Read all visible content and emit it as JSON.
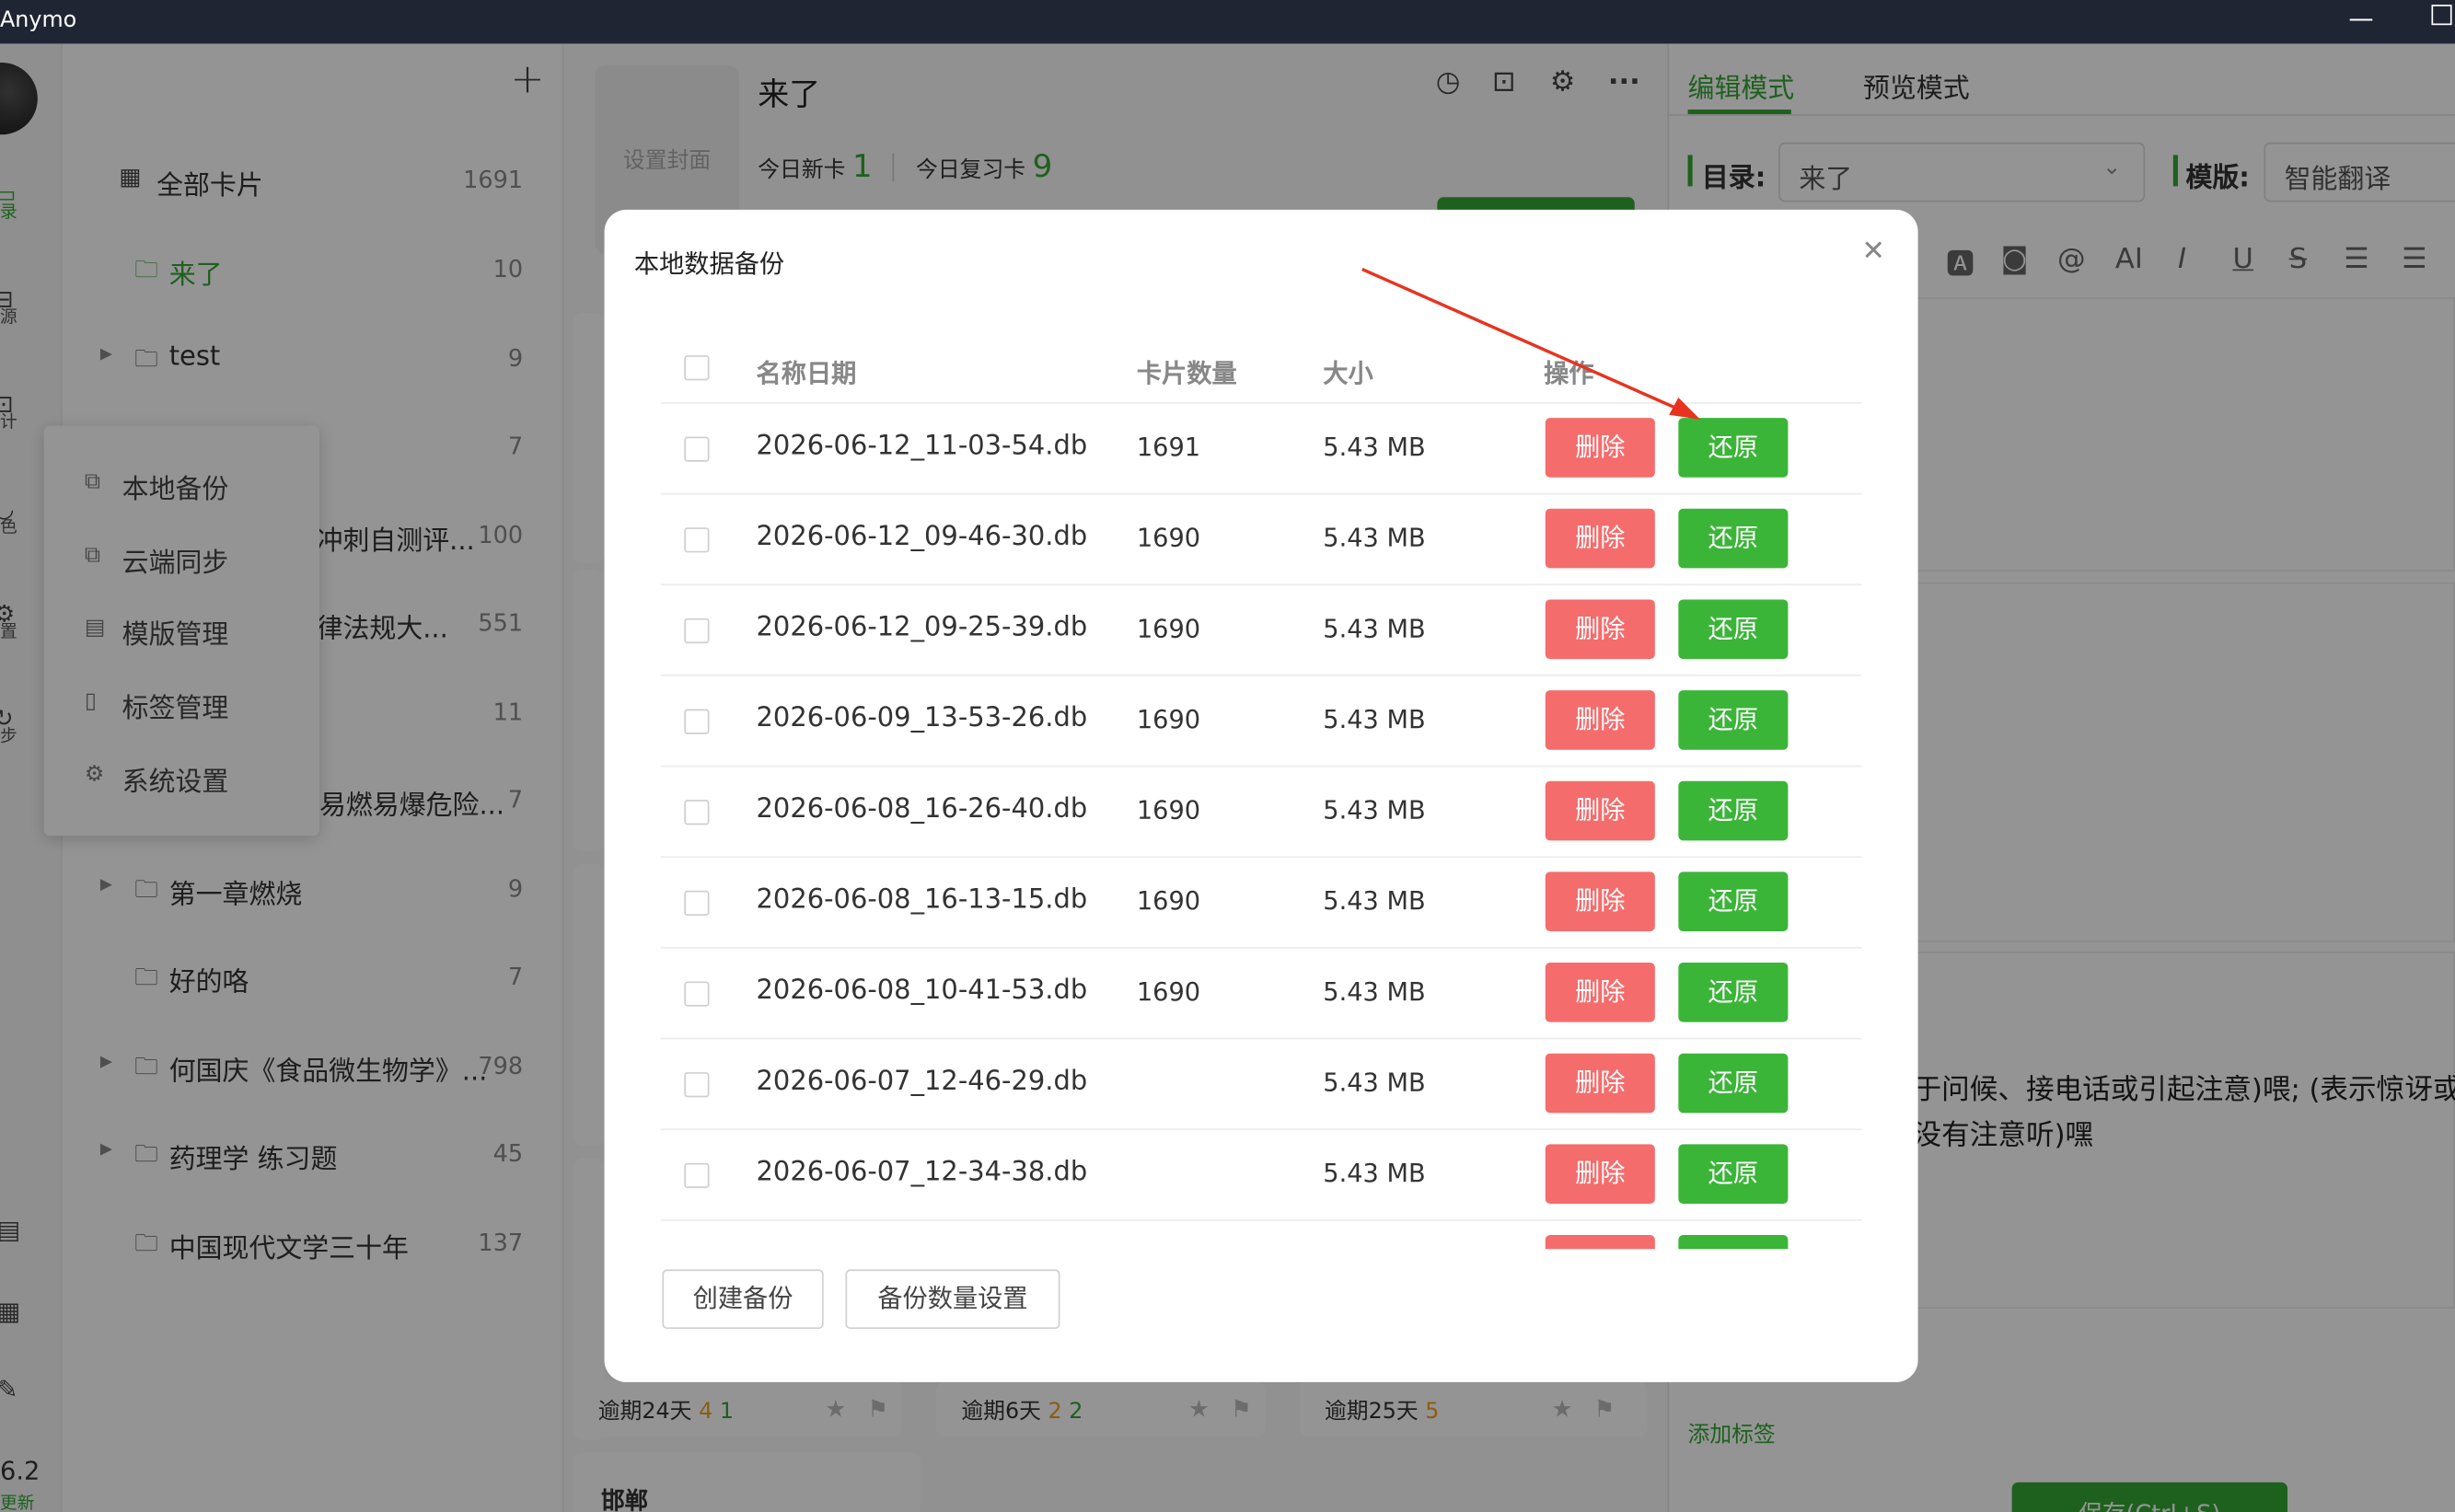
{
  "window": {
    "title": "Anymo"
  },
  "rail": {
    "items": [
      {
        "icon": "monitor-icon",
        "label": "录"
      },
      {
        "icon": "import-icon",
        "label": "源"
      },
      {
        "icon": "stats-icon",
        "label": "计"
      },
      {
        "icon": "palette-icon",
        "label": "色"
      },
      {
        "icon": "gear-icon",
        "label": "置"
      },
      {
        "icon": "sync-icon",
        "label": "步"
      }
    ],
    "version": "6.2",
    "update_label": "更新"
  },
  "folders": {
    "add_label": "+",
    "all_cards": {
      "label": "全部卡片",
      "count": "1691"
    },
    "items": [
      {
        "name": "来了",
        "count": "10",
        "active": true
      },
      {
        "name": "test",
        "count": "9"
      },
      {
        "name": "",
        "count": "7"
      },
      {
        "name": "冲刺自测评...",
        "count": "100"
      },
      {
        "name": "律法规大...",
        "count": "551"
      },
      {
        "name": "",
        "count": "11"
      },
      {
        "name": "易燃易爆危险...",
        "count": "7"
      },
      {
        "name": "第一章燃烧",
        "count": "9"
      },
      {
        "name": "好的咯",
        "count": "7"
      },
      {
        "name": "何国庆《食品微生物学》...",
        "count": "798"
      },
      {
        "name": "药理学 练习题",
        "count": "45"
      },
      {
        "name": "中国现代文学三十年",
        "count": "137"
      }
    ]
  },
  "menu": {
    "items": [
      {
        "label": "本地备份"
      },
      {
        "label": "云端同步"
      },
      {
        "label": "模版管理"
      },
      {
        "label": "标签管理"
      },
      {
        "label": "系统设置"
      }
    ]
  },
  "middle": {
    "cover_label": "设置封面",
    "title": "来了",
    "new_label": "今日新卡",
    "new_count": "1",
    "review_label": "今日复习卡",
    "review_count": "9",
    "card_footers": [
      {
        "text": "逾期24天",
        "n1": "4",
        "n2": "1"
      },
      {
        "text": "逾期6天",
        "n1": "2",
        "n2": "2"
      },
      {
        "text": "逾期25天",
        "n1": "5",
        "n2": ""
      }
    ],
    "bottom_card": "邯郸"
  },
  "right": {
    "tab_edit": "编辑模式",
    "tab_preview": "预览模式",
    "dir_label": "目录:",
    "dir_value": "来了",
    "template_label": "模版:",
    "template_value": "智能翻译",
    "text_line1": "于问候、接电话或引起注意)喂; (表示惊讶或",
    "text_line2": "没有注意听)嘿",
    "add_tag": "添加标签",
    "save_label": "保存(Ctrl+S)"
  },
  "modal": {
    "title": "本地数据备份",
    "columns": [
      "名称日期",
      "卡片数量",
      "大小",
      "操作"
    ],
    "delete_label": "删除",
    "restore_label": "还原",
    "rows": [
      {
        "name": "2026-06-12_11-03-54.db",
        "count": "1691",
        "size": "5.43 MB"
      },
      {
        "name": "2026-06-12_09-46-30.db",
        "count": "1690",
        "size": "5.43 MB"
      },
      {
        "name": "2026-06-12_09-25-39.db",
        "count": "1690",
        "size": "5.43 MB"
      },
      {
        "name": "2026-06-09_13-53-26.db",
        "count": "1690",
        "size": "5.43 MB"
      },
      {
        "name": "2026-06-08_16-26-40.db",
        "count": "1690",
        "size": "5.43 MB"
      },
      {
        "name": "2026-06-08_16-13-15.db",
        "count": "1690",
        "size": "5.43 MB"
      },
      {
        "name": "2026-06-08_10-41-53.db",
        "count": "1690",
        "size": "5.43 MB"
      },
      {
        "name": "2026-06-07_12-46-29.db",
        "count": "",
        "size": "5.43 MB"
      },
      {
        "name": "2026-06-07_12-34-38.db",
        "count": "",
        "size": "5.43 MB"
      },
      {
        "name": "",
        "count": "",
        "size": ""
      }
    ],
    "create_backup": "创建备份",
    "backup_settings": "备份数量设置"
  },
  "colors": {
    "accent": "#35a535",
    "danger": "#f56c6c",
    "titlebar": "#1f2532"
  }
}
